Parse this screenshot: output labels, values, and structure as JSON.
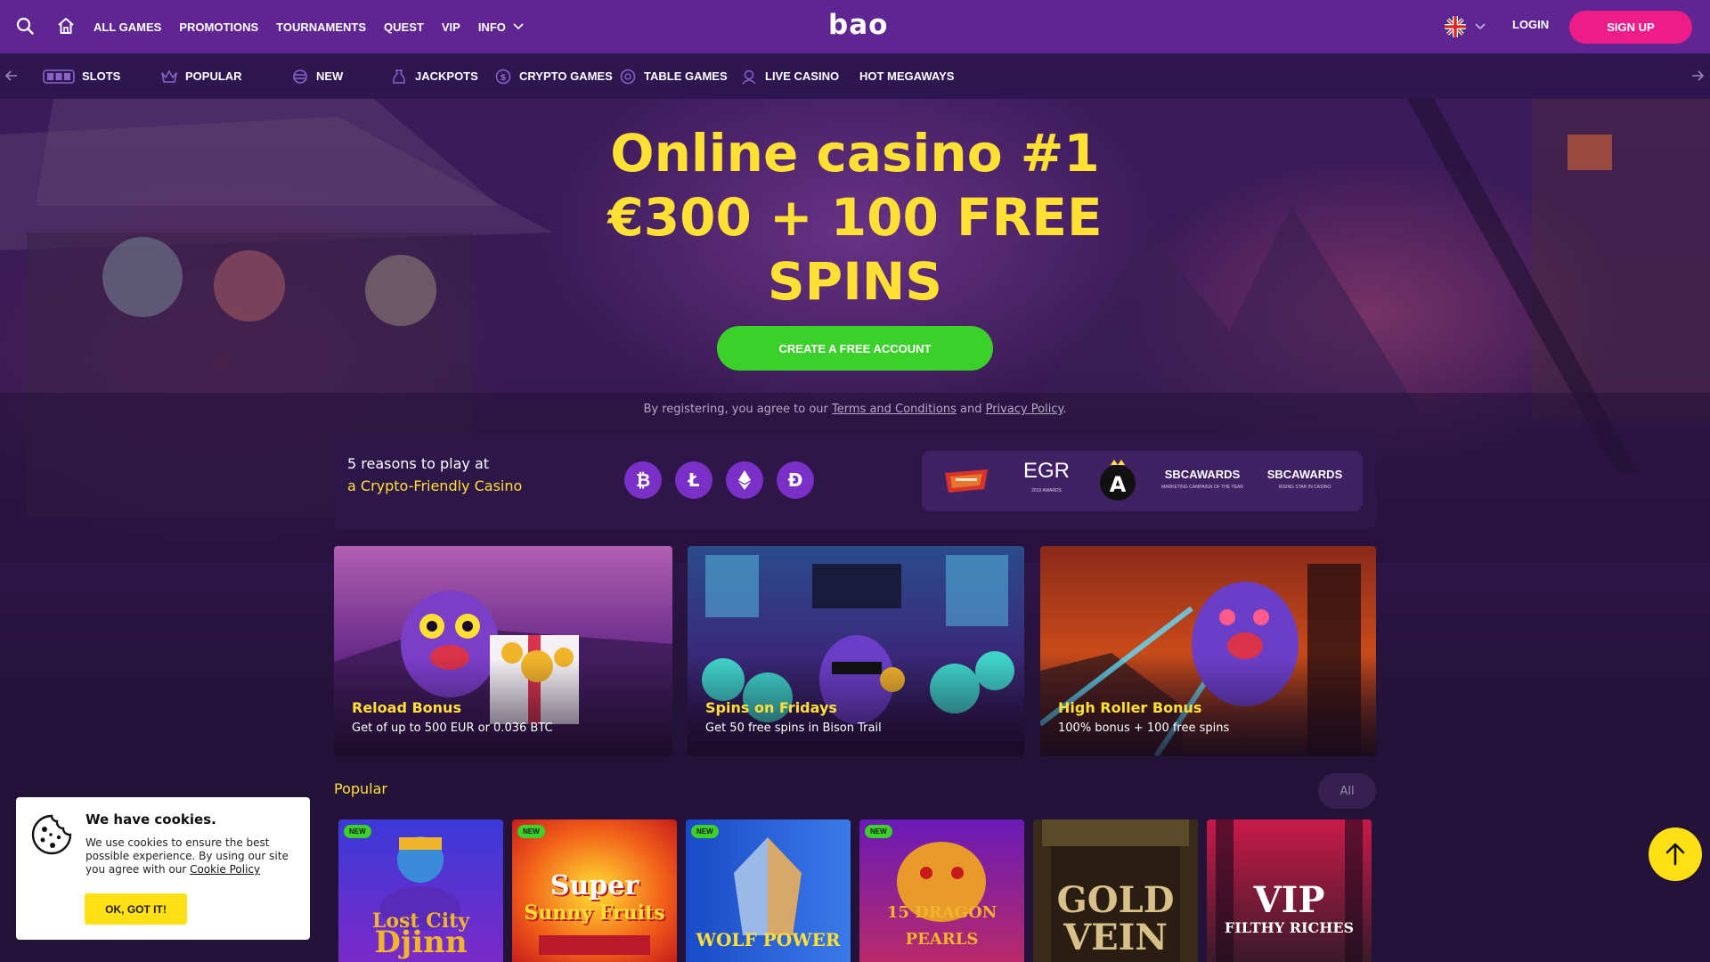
{
  "header": {
    "logo": "bao",
    "nav": [
      "ALL GAMES",
      "PROMOTIONS",
      "TOURNAMENTS",
      "QUEST",
      "VIP",
      "INFO"
    ],
    "login": "LOGIN",
    "signup": "SIGN UP",
    "language_icon": "uk-flag-icon"
  },
  "categories": [
    {
      "label": "SLOTS",
      "icon": "slots-icon"
    },
    {
      "label": "POPULAR",
      "icon": "crown-icon"
    },
    {
      "label": "NEW",
      "icon": "new-icon"
    },
    {
      "label": "JACKPOTS",
      "icon": "jackpot-icon"
    },
    {
      "label": "CRYPTO GAMES",
      "icon": "crypto-icon"
    },
    {
      "label": "TABLE GAMES",
      "icon": "table-games-icon"
    },
    {
      "label": "LIVE CASINO",
      "icon": "live-casino-icon"
    },
    {
      "label": "HOT MEGAWAYS",
      "icon": ""
    }
  ],
  "hero": {
    "line1": "Online casino #1",
    "line2": "€300 + 100 FREE",
    "line3": "SPINS",
    "cta": "CREATE A FREE ACCOUNT",
    "legal_prefix": "By registering, you agree to our ",
    "legal_terms": "Terms and Conditions",
    "legal_and": " and ",
    "legal_privacy": "Privacy Policy",
    "legal_suffix": "."
  },
  "reasons": {
    "line1": "5 reasons to play at",
    "line2": "a Crypto-Friendly Casino",
    "coins": [
      "bitcoin-icon",
      "litecoin-icon",
      "ethereum-icon",
      "dogecoin-icon"
    ],
    "awards": [
      {
        "main": "EGR",
        "sub": "2019 AWARDS"
      },
      {
        "main": "SBCAWARDS",
        "sub": "MARKETING CAMPAIGN OF THE YEAR"
      },
      {
        "main": "SBCAWARDS",
        "sub": "RISING STAR IN CASINO"
      }
    ]
  },
  "promos": [
    {
      "title": "Reload Bonus",
      "subtitle": "Get of up to 500 EUR or 0.036 BTC"
    },
    {
      "title": "Spins on Fridays",
      "subtitle": "Get 50 free spins in Bison Trail"
    },
    {
      "title": "High Roller Bonus",
      "subtitle": "100% bonus + 100 free spins"
    }
  ],
  "popular": {
    "title": "Popular",
    "all": "All",
    "games": [
      {
        "name": "Lost City of the Djinn",
        "line1": "Lost City",
        "line2": "Djinn",
        "badge": "NEW"
      },
      {
        "name": "Super Sunny Fruits",
        "line1": "Super",
        "line2": "Sunny Fruits",
        "badge": "NEW"
      },
      {
        "name": "Wolf Power",
        "line1": "",
        "line2": "WOLF POWER",
        "badge": "NEW"
      },
      {
        "name": "15 Dragon Pearls",
        "line1": "",
        "line2": "15 DRAGON PEARLS",
        "badge": "NEW"
      },
      {
        "name": "Gold Vein",
        "line1": "GOLD",
        "line2": "VEIN",
        "badge": ""
      },
      {
        "name": "VIP Filthy Riches",
        "line1": "VIP",
        "line2": "FILTHY RICHES",
        "badge": ""
      }
    ]
  },
  "cookie": {
    "title": "We have cookies.",
    "text": "We use cookies to ensure the best possible experience. By using our site you agree with our ",
    "link": "Cookie Policy",
    "button": "OK, GOT IT!"
  },
  "colors": {
    "topbar": "#5e2593",
    "accent_yellow": "#ffe033",
    "cta_green": "#3bd12a",
    "signup_pink": "#ee1c87"
  }
}
